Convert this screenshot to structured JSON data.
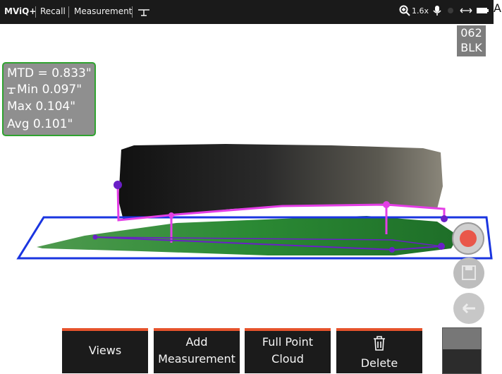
{
  "topbar": {
    "brand": "MViQ+",
    "breadcrumb_1": "Recall",
    "breadcrumb_2": "Measurement",
    "mode_icon": "pit-depth-icon",
    "zoom_label": "1.6x",
    "status_icons": [
      "zoom-icon",
      "microphone-icon",
      "brightness-icon",
      "articulation-icon",
      "battery-icon"
    ]
  },
  "corner_text": "A",
  "probe_tag": {
    "line1": "062",
    "line2": "BLK"
  },
  "measurement": {
    "mtd": "MTD = 0.833\"",
    "min": "Min 0.097\"",
    "max": "Max 0.104\"",
    "avg": "Avg 0.101\"",
    "min_icon": "pit-depth-icon"
  },
  "colors": {
    "accent": "#e5532c",
    "reference_plane": "#1a35e0",
    "profile_line": "#e43ee6",
    "cursor": "#6a1fc7",
    "box_border": "#2fa32f",
    "record_red": "#e9574a"
  },
  "side_buttons": [
    "record-icon",
    "save-icon",
    "back-icon"
  ],
  "toolbar": {
    "views": "Views",
    "add_line1": "Add",
    "add_line2": "Measurement",
    "cloud_line1": "Full Point",
    "cloud_line2": "Cloud",
    "delete": "Delete",
    "delete_icon": "trash-icon"
  }
}
